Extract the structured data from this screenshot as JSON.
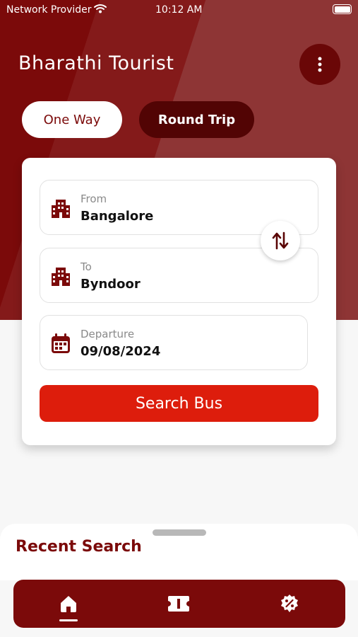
{
  "status_bar": {
    "carrier": "Network Provider",
    "time": "10:12 AM"
  },
  "header": {
    "title": "Bharathi Tourist",
    "menu_icon": "more-vertical-icon"
  },
  "trip_tabs": [
    {
      "label": "One Way",
      "selected": true
    },
    {
      "label": "Round Trip",
      "selected": false
    }
  ],
  "search_form": {
    "from": {
      "label": "From",
      "value": "Bangalore",
      "icon": "building-icon"
    },
    "to": {
      "label": "To",
      "value": "Byndoor",
      "icon": "building-icon"
    },
    "departure": {
      "label": "Departure",
      "value": "09/08/2024",
      "icon": "calendar-icon"
    },
    "swap_icon": "swap-vertical-icon",
    "search_label": "Search Bus"
  },
  "recent": {
    "title": "Recent Search"
  },
  "bottom_nav": [
    {
      "name": "home",
      "icon": "home-icon",
      "active": true
    },
    {
      "name": "tickets",
      "icon": "ticket-icon",
      "active": false
    },
    {
      "name": "offers",
      "icon": "offer-badge-icon",
      "active": false
    }
  ],
  "colors": {
    "primary": "#7b0a0a",
    "accent": "#dd1d0c",
    "dark_tab": "#520404"
  }
}
